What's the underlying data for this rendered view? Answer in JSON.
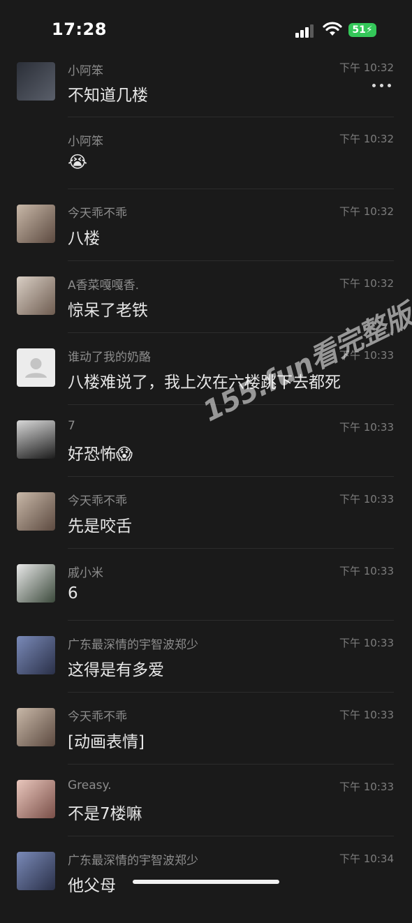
{
  "status_bar": {
    "time": "17:28",
    "battery": "51"
  },
  "watermark": "155.fun看完整版",
  "messages": [
    {
      "name": "小阿笨",
      "time": "下午 10:32",
      "text": "不知道几楼",
      "avatar_color": "#3b3f4a"
    },
    {
      "name": "小阿笨",
      "time": "下午 10:32",
      "text": "",
      "emoji": "😭"
    },
    {
      "name": "今天乖不乖",
      "time": "下午 10:32",
      "text": "八楼",
      "avatar_color": "#6b5a50"
    },
    {
      "name": "A香菜嘎嘎香.",
      "time": "下午 10:32",
      "text": "惊呆了老铁",
      "avatar_color": "#8b7a6c"
    },
    {
      "name": "谁动了我的奶酪",
      "time": "下午 10:33",
      "text": "八楼难说了，我上次在六楼跳下去都死",
      "avatar_color": "#e9e9e9"
    },
    {
      "name": "7",
      "time": "下午 10:33",
      "text": "好恐怖😱",
      "avatar_color": "#3a3a3a"
    },
    {
      "name": "今天乖不乖",
      "time": "下午 10:33",
      "text": "先是咬舌",
      "avatar_color": "#6b5a50"
    },
    {
      "name": "戚小米",
      "time": "下午 10:33",
      "text": "6",
      "avatar_color": "#4a5a4a"
    },
    {
      "name": "广东最深情的宇智波郑少",
      "time": "下午 10:33",
      "text": "这得是有多爱",
      "avatar_color": "#3e4e6e"
    },
    {
      "name": "今天乖不乖",
      "time": "下午 10:33",
      "text": "[动画表情]",
      "avatar_color": "#6b5a50"
    },
    {
      "name": "Greasy.",
      "time": "下午 10:33",
      "text": "不是7楼嘛",
      "avatar_color": "#a0746a"
    },
    {
      "name": "广东最深情的宇智波郑少",
      "time": "下午 10:34",
      "text": "他父母",
      "avatar_color": "#3e4e6e"
    }
  ]
}
